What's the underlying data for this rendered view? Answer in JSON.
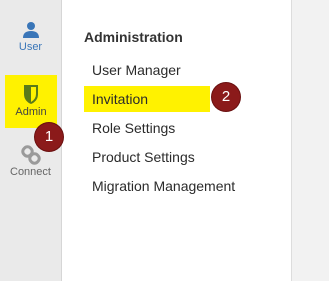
{
  "rail": {
    "items": [
      {
        "label": "User",
        "icon": "user-icon",
        "color": "#3a76b8"
      },
      {
        "label": "Admin",
        "icon": "shield-icon",
        "color": "#5a7a1a",
        "highlighted": true
      },
      {
        "label": "Connect",
        "icon": "link-icon",
        "color": "#888888"
      }
    ]
  },
  "menu": {
    "title": "Administration",
    "items": [
      {
        "label": "User Manager"
      },
      {
        "label": "Invitation",
        "highlighted": true
      },
      {
        "label": "Role Settings"
      },
      {
        "label": "Product Settings"
      },
      {
        "label": "Migration Management"
      }
    ]
  },
  "markers": {
    "one": "1",
    "two": "2"
  },
  "colors": {
    "highlight": "#fff200",
    "marker": "#8b1a1a"
  }
}
